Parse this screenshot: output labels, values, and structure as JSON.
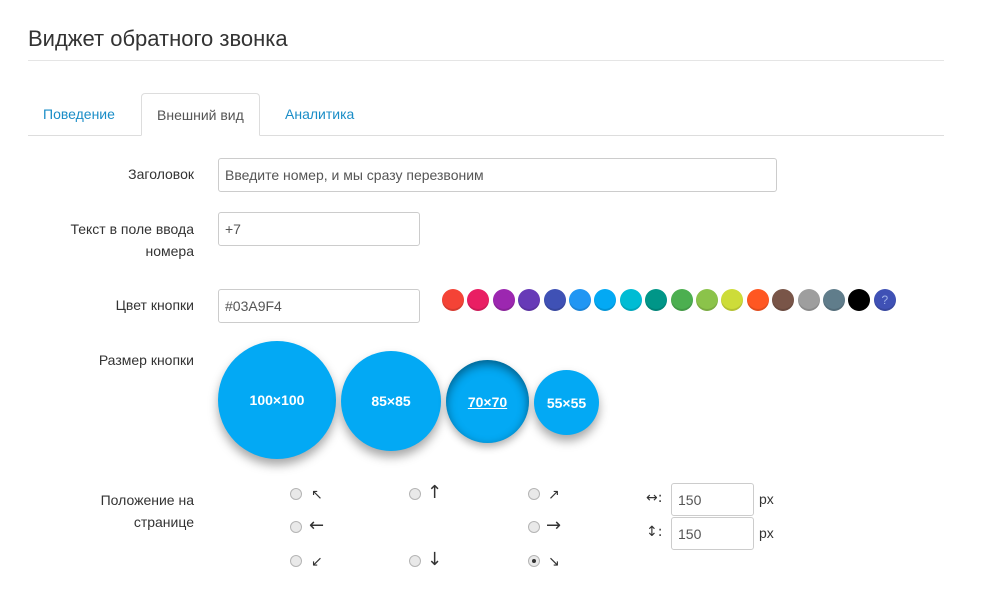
{
  "page": {
    "title": "Виджет обратного звонка"
  },
  "tabs": [
    {
      "label": "Поведение",
      "active": false
    },
    {
      "label": "Внешний вид",
      "active": true
    },
    {
      "label": "Аналитика",
      "active": false
    }
  ],
  "form": {
    "header": {
      "label": "Заголовок",
      "value": "Введите номер, и мы сразу перезвоним"
    },
    "phone_text": {
      "label_line1": "Текст в поле ввода",
      "label_line2": "номера",
      "value": "+7"
    },
    "button_color": {
      "label": "Цвет кнопки",
      "value": "#03A9F4"
    },
    "button_size": {
      "label": "Размер кнопки"
    },
    "position": {
      "label_line1": "Положение на",
      "label_line2": "странице"
    }
  },
  "palette": [
    "#F44336",
    "#E91E63",
    "#9C27B0",
    "#673AB7",
    "#3F51B5",
    "#2196F3",
    "#03A9F4",
    "#00BCD4",
    "#009688",
    "#4CAF50",
    "#8BC34A",
    "#CDDC39",
    "#FF5722",
    "#795548",
    "#9E9E9E",
    "#607D8B",
    "#000000"
  ],
  "palette_custom": {
    "icon": "?",
    "color": "#3F51B5"
  },
  "sizes": [
    {
      "label": "100×100",
      "selected": false
    },
    {
      "label": "85×85",
      "selected": false
    },
    {
      "label": "70×70",
      "selected": true
    },
    {
      "label": "55×55",
      "selected": false
    }
  ],
  "accent_color": "#03A9F4",
  "positions": {
    "top_left": "↖",
    "top": "↑",
    "top_right": "↗",
    "left": "←",
    "right": "→",
    "bottom_left": "↙",
    "bottom": "↓",
    "bottom_right": "↘",
    "selected": "bottom_right"
  },
  "offsets": {
    "horizontal": {
      "label": "↔:",
      "value": "150",
      "unit": "px"
    },
    "vertical": {
      "label": "↕:",
      "value": "150",
      "unit": "px"
    }
  }
}
